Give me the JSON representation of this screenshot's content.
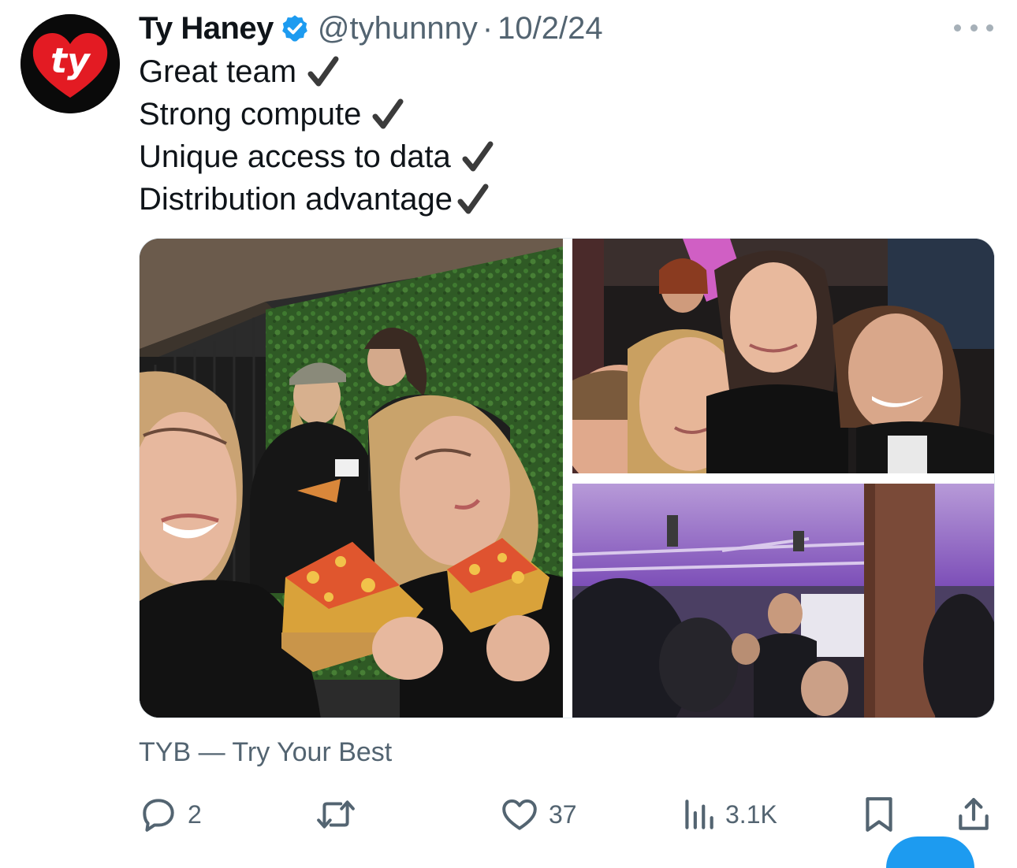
{
  "tweet": {
    "display_name": "Ty Haney",
    "verified_icon": "verified-badge-icon",
    "handle": "@tyhunnny",
    "separator": "·",
    "date": "10/2/24",
    "lines": [
      "Great team",
      "Strong compute",
      "Unique access to data",
      "Distribution advantage"
    ],
    "source": "TYB — Try Your Best"
  },
  "avatar": {
    "logo_text": "ty",
    "colors": {
      "background": "#0a0a0a",
      "heart": "#e31b23",
      "text": "#ffffff"
    }
  },
  "actions": {
    "reply_count": "2",
    "retweet_count": "",
    "like_count": "37",
    "views_count": "3.1K"
  },
  "colors": {
    "text_primary": "#0f1419",
    "text_secondary": "#536471",
    "verified_blue": "#1d9bf0",
    "border": "#e1e8ed"
  }
}
